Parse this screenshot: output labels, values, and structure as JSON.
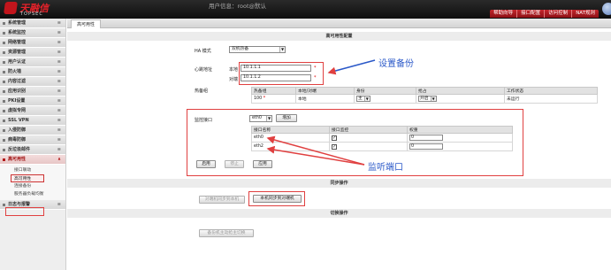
{
  "header": {
    "logo_cn": "天融信",
    "logo_en": "TOPSEC",
    "user_info": "用户信息：root@默认",
    "nav": [
      "帮助向导",
      "接口配置",
      "访问控制",
      "NAT规则"
    ]
  },
  "sidebar": {
    "items": [
      {
        "label": "系统管理"
      },
      {
        "label": "系统监控"
      },
      {
        "label": "网络管理"
      },
      {
        "label": "资源管理"
      },
      {
        "label": "用户认证"
      },
      {
        "label": "防火墙"
      },
      {
        "label": "内容过滤"
      },
      {
        "label": "应用识别"
      },
      {
        "label": "PKI设置"
      },
      {
        "label": "虚拟专网"
      },
      {
        "label": "SSL VPN"
      },
      {
        "label": "入侵防御"
      },
      {
        "label": "病毒防御"
      },
      {
        "label": "反垃圾邮件"
      },
      {
        "label": "高可用性"
      },
      {
        "label": "日志与报警"
      }
    ],
    "sub_items": [
      "接口联动",
      "高可用性",
      "连接备份",
      "服务器负载均衡"
    ]
  },
  "main": {
    "tab": "高可用性",
    "section_config": "高可用性配置",
    "mode_label": "HA 模式",
    "mode_value": "双机热备",
    "heartbeat_label": "心跳地址",
    "local_label": "本地",
    "local_ip": "10.1.1.1",
    "peer_label": "对端",
    "peer_ip": "10.1.1.2",
    "group_label": "热备组",
    "group_headers": [
      "热备组",
      "本地/对端",
      "身份",
      "抢占",
      "工作状态"
    ],
    "group_row": {
      "id": "100",
      "side": "本地",
      "role": "主",
      "preempt": "开启",
      "status": "未运行"
    },
    "monitor_label": "监控接口",
    "monitor_select": "eth0",
    "add_button": "增加",
    "iface_headers": [
      "接口名称",
      "接口监控",
      "权重"
    ],
    "iface_rows": [
      {
        "name": "eth0",
        "checked": "✓",
        "weight": "0"
      },
      {
        "name": "eth2",
        "checked": "✓",
        "weight": "0"
      }
    ],
    "buttons": {
      "apply": "启用",
      "stop": "停止",
      "save": "应用"
    },
    "section_sync": "同步操作",
    "sync_btn_1": "对端机同步到本机",
    "sync_btn_2": "本机同步到对端机",
    "section_switch": "切换操作",
    "switch_btn": "备份机主动抢主切换"
  },
  "annotations": {
    "backup": "设置备份",
    "monitor": "监听端口"
  },
  "colors": {
    "brand_red": "#c2151c",
    "annotation_red": "#e04040",
    "annotation_blue": "#2a58c8"
  }
}
